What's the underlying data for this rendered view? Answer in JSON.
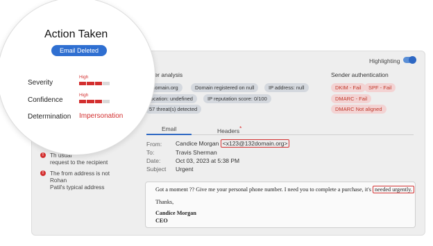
{
  "highlighting": {
    "label": "Highlighting",
    "on": true
  },
  "sender_analysis": {
    "title": "nder analysis",
    "chips": [
      "2domain.org",
      "Domain registered on null",
      "IP address: null",
      "location: undefined",
      "IP reputation score: 0/100",
      "57 threat(s) detected"
    ]
  },
  "sender_auth": {
    "title": "Sender authentication",
    "chips": [
      "DKIM - Fail",
      "SPF - Fail",
      "DMARC - Fail",
      "DMARC Not aligned"
    ]
  },
  "tabs": {
    "email": "Email",
    "headers": "Headers",
    "headers_marker": "*"
  },
  "email_meta": {
    "from_label": "From:",
    "from_name": "Candice Morgan",
    "from_address": "<x123@132domain.org>",
    "to_label": "To:",
    "to_value": "Travis Sherman",
    "date_label": "Date:",
    "date_value": "Oct 03, 2023 at 5:38 PM",
    "subject_label": "Subject",
    "subject_value": "Urgent"
  },
  "email_body": {
    "line1_prefix": "Got a moment ?? Give me your personal phone number. I need you to complete a purchase, it's",
    "line1_highlight": "needed urgently.",
    "thanks": "Thanks,",
    "sig_name": "Candice Morgan",
    "sig_title": "CEO"
  },
  "reasons": [
    {
      "text": "Th... usual request to the recipient",
      "line1": "Th                       usual",
      "line2": "request to the recipient"
    },
    {
      "line1": "The from address is not Rohan",
      "line2": "Patil's typical address"
    }
  ],
  "magnifier": {
    "title": "Action Taken",
    "badge": "Email Deleted",
    "severity_label": "Severity",
    "severity_level": "High",
    "severity_value": 0.75,
    "confidence_label": "Confidence",
    "confidence_level": "High",
    "confidence_value": 0.75,
    "determination_label": "Determination",
    "determination_value": "Impersonation"
  },
  "colors": {
    "accent": "#2f6fd1",
    "danger": "#d32f2f",
    "chip_grey": "#d4d8de",
    "chip_red": "#f3d3d3"
  }
}
